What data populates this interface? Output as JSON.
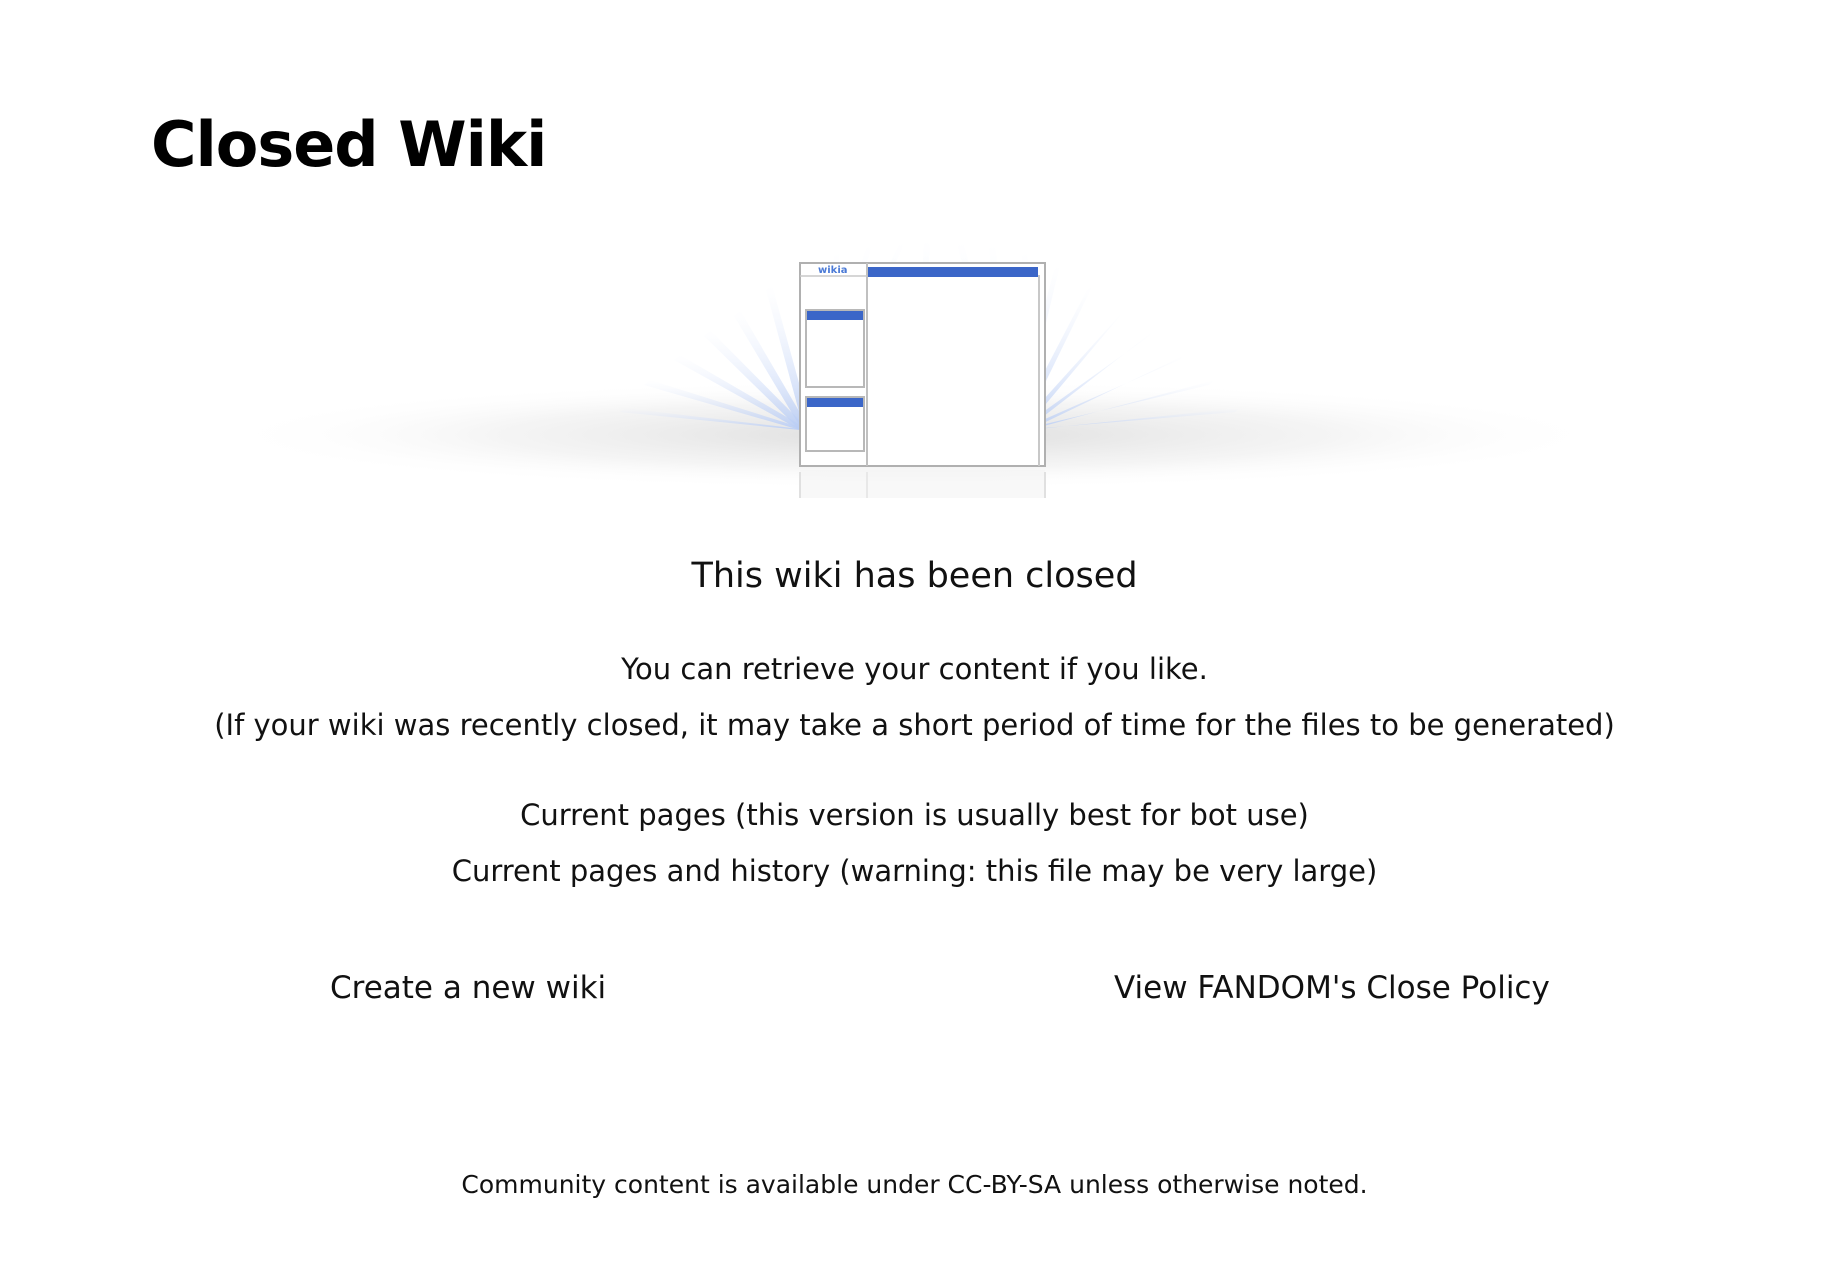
{
  "page": {
    "title": "Closed Wiki"
  },
  "illustration": {
    "icon": "closed-wiki-illustration",
    "logo_text": "wikia",
    "accent_color": "#3b66c8",
    "ray_color": "#c9d8f6"
  },
  "main": {
    "heading": "This wiki has been closed",
    "retrieve_text": "You can retrieve your content if you like.",
    "note_text": "(If your wiki was recently closed, it may take a short period of time for the files to be generated)",
    "current_pages_link": "Current pages (this version is usually best for bot use)",
    "history_link": "Current pages and history (warning: this file may be very large)"
  },
  "actions": {
    "create_wiki": "Create a new wiki",
    "close_policy": "View FANDOM's Close Policy"
  },
  "footer": {
    "license_text": "Community content is available under CC-BY-SA unless otherwise noted."
  }
}
